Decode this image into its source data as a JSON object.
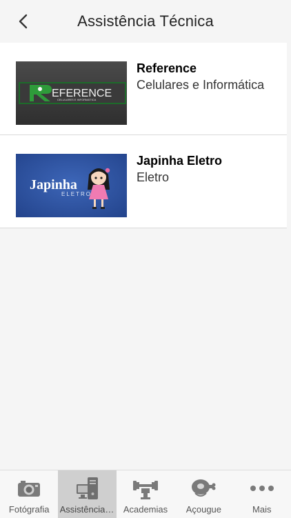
{
  "header": {
    "title": "Assistência Técnica"
  },
  "items": [
    {
      "title": "Reference",
      "subtitle": "Celulares e Informática",
      "logo_text": "EFERENCE",
      "logo_sub": "CELULARES E INFORMÁTICA",
      "logo_color": "#2e9b3a"
    },
    {
      "title": "Japinha Eletro",
      "subtitle": "Eletro",
      "logo_text": "Japinha",
      "logo_sub": "ELETRO",
      "logo_color": "#2c4f9e"
    }
  ],
  "tabs": [
    {
      "label": "Fotógrafia",
      "icon": "camera-icon",
      "active": false
    },
    {
      "label": "Assistência Técnica",
      "icon": "computer-icon",
      "active": true
    },
    {
      "label": "Academias",
      "icon": "dumbbell-icon",
      "active": false
    },
    {
      "label": "Açougue",
      "icon": "meat-icon",
      "active": false
    },
    {
      "label": "Mais",
      "icon": "more-icon",
      "active": false
    }
  ]
}
